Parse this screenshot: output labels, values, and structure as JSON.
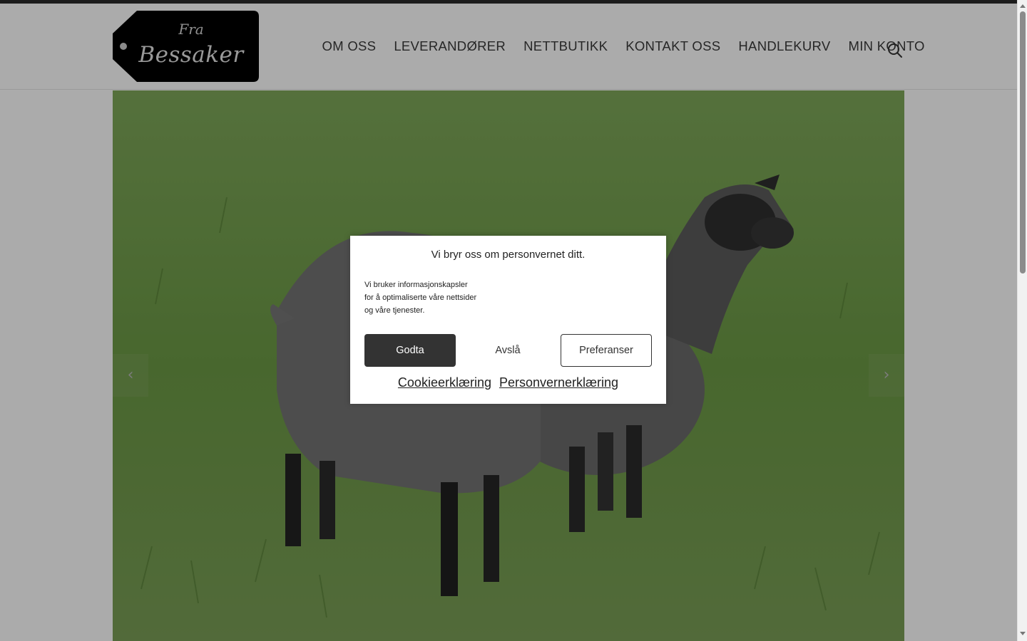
{
  "logo": {
    "line1": "Fra",
    "line2": "Bessaker"
  },
  "nav": {
    "items": [
      {
        "label": "OM OSS"
      },
      {
        "label": "LEVERANDØRER"
      },
      {
        "label": "NETTBUTIKK"
      },
      {
        "label": "KONTAKT OSS"
      },
      {
        "label": "HANDLEKURV"
      },
      {
        "label": "MIN KONTO"
      }
    ],
    "search_icon": "search-icon"
  },
  "hero": {
    "image_subject": "two grey sheep in a grass field",
    "prev_icon": "‹",
    "next_icon": "›"
  },
  "cookie_dialog": {
    "title": "Vi bryr oss om personvernet ditt.",
    "text": "Vi bruker informasjonskapsler for å optimaliserte våre nettsider og våre tjenester.",
    "accept_label": "Godta",
    "deny_label": "Avslå",
    "preferences_label": "Preferanser",
    "cookie_policy_link": "Cookieerklæring",
    "privacy_policy_link": "Personvernerklæring"
  },
  "colors": {
    "accent": "#333333",
    "overlay": "rgba(0,0,0,0.33)",
    "nav_text": "#3a3a3a"
  }
}
